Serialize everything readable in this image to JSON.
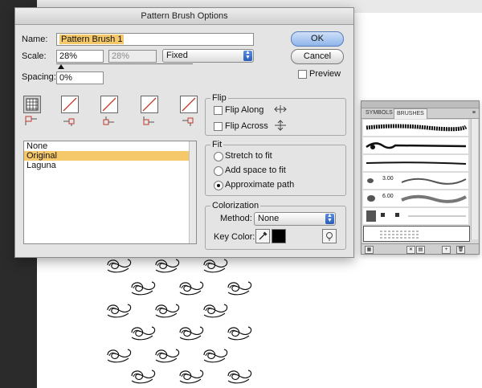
{
  "dialog": {
    "title": "Pattern Brush Options",
    "name_label": "Name:",
    "name_value": "Pattern Brush 1",
    "scale_label": "Scale:",
    "scale_value": "28%",
    "scale_value_dim": "28%",
    "scale_mode": "Fixed",
    "spacing_label": "Spacing:",
    "spacing_value": "0%",
    "ok_label": "OK",
    "cancel_label": "Cancel",
    "preview_label": "Preview",
    "tiles_list": [
      "None",
      "Original",
      "Laguna"
    ],
    "selected_tile": "Original",
    "flip": {
      "title": "Flip",
      "along_label": "Flip Along",
      "across_label": "Flip Across"
    },
    "fit": {
      "title": "Fit",
      "options": [
        "Stretch to fit",
        "Add space to fit",
        "Approximate path"
      ],
      "selected": "Approximate path"
    },
    "colorization": {
      "title": "Colorization",
      "method_label": "Method:",
      "method_value": "None",
      "keycolor_label": "Key Color:",
      "key_color": "#000000"
    }
  },
  "brushes_panel": {
    "tabs": [
      "SYMBOLS",
      "BRUSHES"
    ],
    "active_tab": "BRUSHES",
    "size_labels": [
      "3.00",
      "6.00"
    ]
  },
  "colors": {
    "selection": "#f5c86a",
    "dialog_bg": "#e4e4e4",
    "left_bar": "#2b2b2b"
  }
}
